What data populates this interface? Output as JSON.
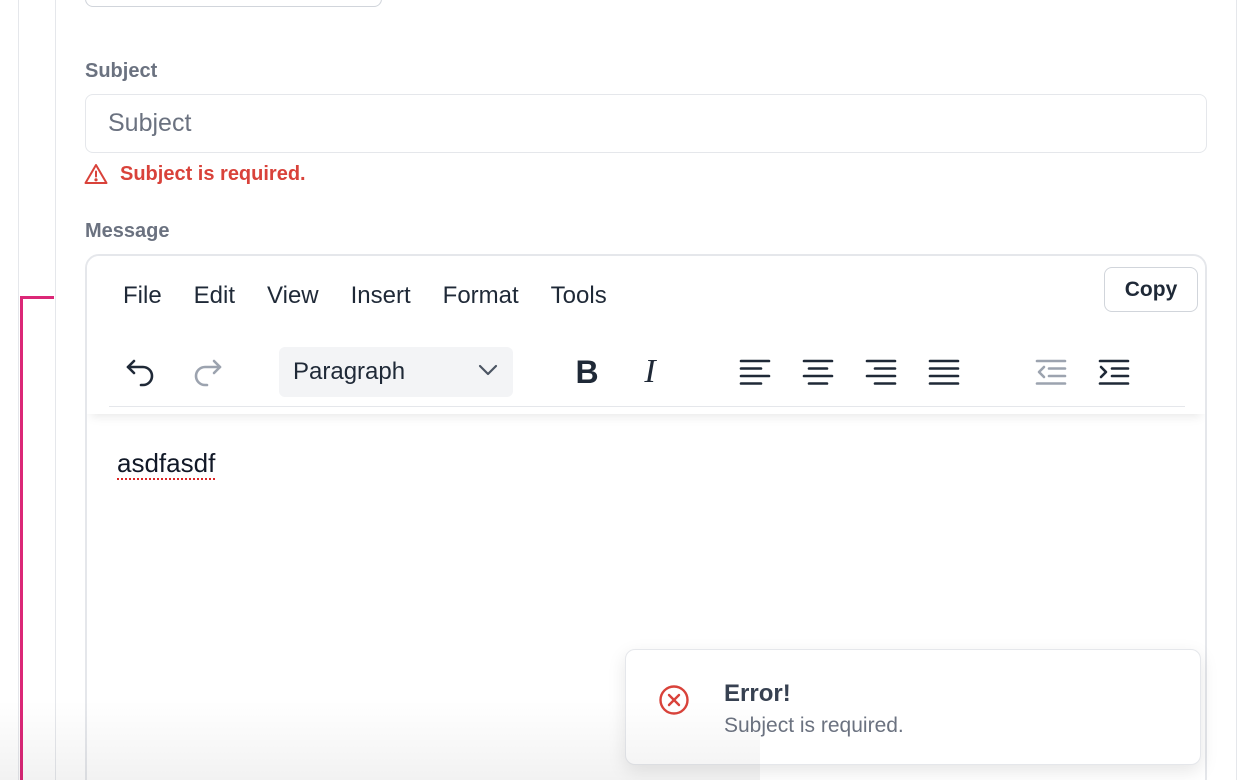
{
  "form": {
    "subject_label": "Subject",
    "subject_placeholder": "Subject",
    "subject_value": "",
    "subject_error": "Subject is required.",
    "message_label": "Message"
  },
  "editor": {
    "menus": [
      "File",
      "Edit",
      "View",
      "Insert",
      "Format",
      "Tools"
    ],
    "copy_label": "Copy",
    "block_format": "Paragraph",
    "bold_glyph": "B",
    "italic_glyph": "I",
    "content": "asdfasdf",
    "toolbar_icons": [
      "undo-icon",
      "redo-icon",
      "bold-icon",
      "italic-icon",
      "align-left-icon",
      "align-center-icon",
      "align-right-icon",
      "align-justify-icon",
      "outdent-icon",
      "indent-icon"
    ]
  },
  "toast": {
    "title": "Error!",
    "message": "Subject is required."
  },
  "colors": {
    "error": "#d9423a",
    "accent_line": "#db2777",
    "label": "#6b7280",
    "border": "#e5e7eb"
  }
}
